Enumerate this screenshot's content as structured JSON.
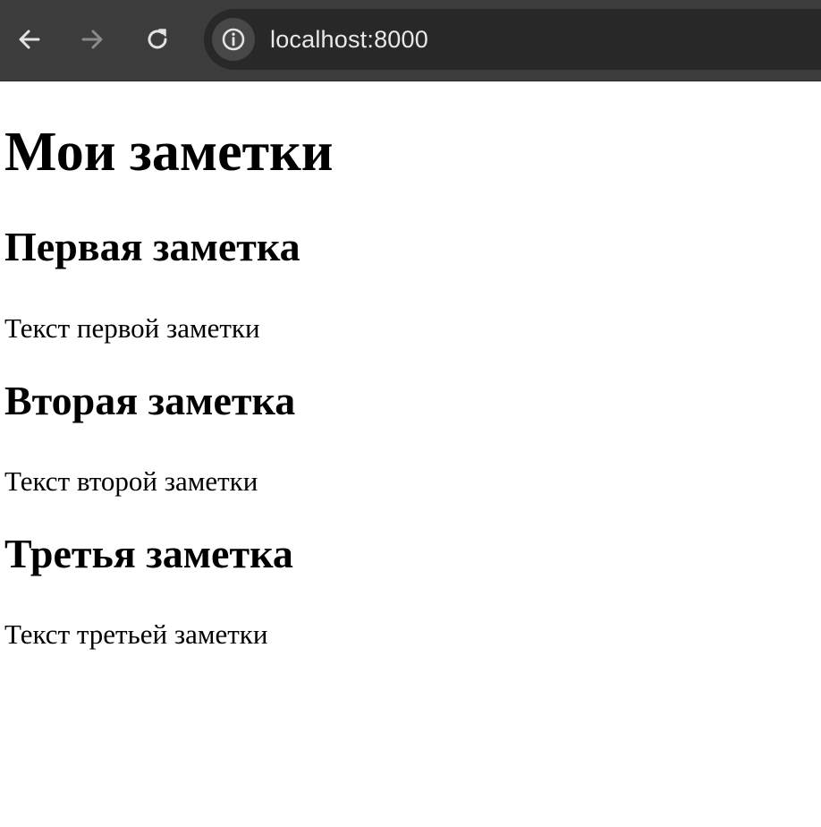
{
  "browser": {
    "url": "localhost:8000",
    "icons": {
      "back": "arrow-left-icon",
      "forward": "arrow-right-icon",
      "reload": "reload-icon",
      "site_info": "info-icon"
    },
    "colors": {
      "toolbar": "#3c3c3c",
      "address_bar": "#282828",
      "icon_active": "#e3e3e3",
      "icon_disabled": "#8a8a8a"
    }
  },
  "page": {
    "title": "Мои заметки",
    "notes": [
      {
        "title": "Первая заметка",
        "text": "Текст первой заметки"
      },
      {
        "title": "Вторая заметка",
        "text": "Текст второй заметки"
      },
      {
        "title": "Третья заметка",
        "text": "Текст третьей заметки"
      }
    ]
  }
}
